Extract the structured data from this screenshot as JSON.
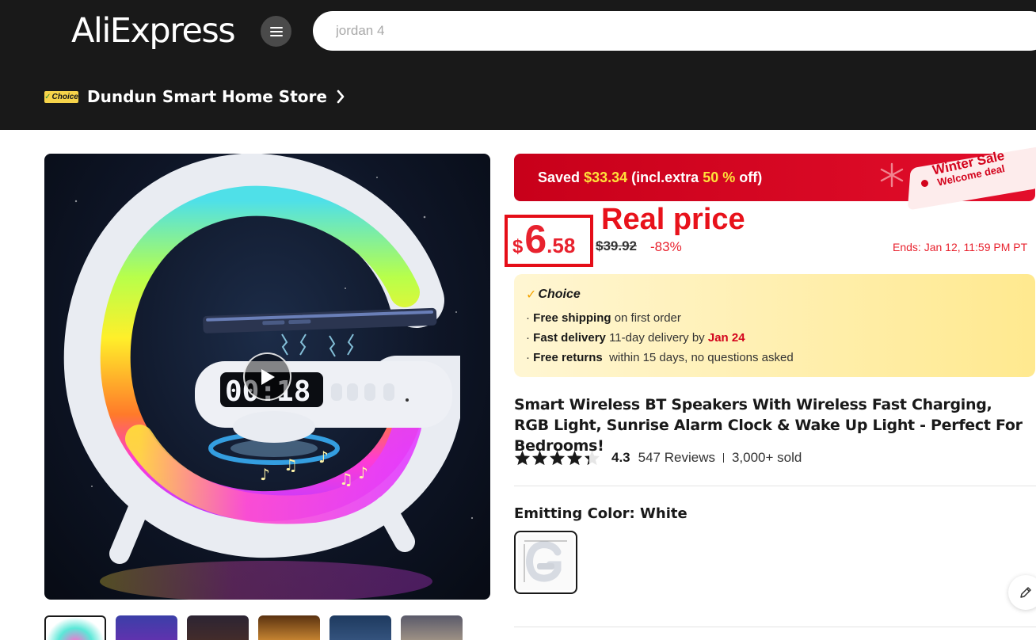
{
  "header": {
    "logo": "AliExpress",
    "menu_icon": "hamburger-icon",
    "search_placeholder": "jordan 4",
    "store_badge": "Choice",
    "store_name": "Dundun Smart Home Store"
  },
  "gallery": {
    "play_icon": "play-icon",
    "thumbnail_count": 7
  },
  "promo": {
    "saved_prefix": "Saved",
    "saved_amount": "$33.34",
    "saved_mid": "(incl.extra",
    "saved_percent": "50 %",
    "saved_suffix": "off)",
    "tag_line1": "Winter Sale",
    "tag_line2": "Welcome deal"
  },
  "price": {
    "currency": "$",
    "integer": "6",
    "decimal": ".58",
    "annotation": "Real price",
    "original": "$39.92",
    "discount": "-83%",
    "ends": "Ends: Jan 12, 11:59 PM PT"
  },
  "choice": {
    "title": "Choice",
    "shipping_bold": "Free shipping",
    "shipping_rest": "on first order",
    "delivery_bold": "Fast delivery",
    "delivery_rest": "11-day delivery by",
    "delivery_date": "Jan 24",
    "returns_bold": "Free returns",
    "returns_rest": "within 15 days, no questions asked"
  },
  "product": {
    "title": "Smart Wireless BT Speakers With Wireless Fast Charging, RGB Light, Sunrise Alarm Clock & Wake Up Light - Perfect For Bedrooms!",
    "rating": "4.3",
    "rating_value": 4.3,
    "reviews": "547 Reviews",
    "sold": "3,000+ sold",
    "color_label": "Emitting Color: White"
  },
  "colors": {
    "header_bg": "#191919",
    "accent_red": "#e8222e",
    "choice_yellow": "#ffe98f"
  }
}
